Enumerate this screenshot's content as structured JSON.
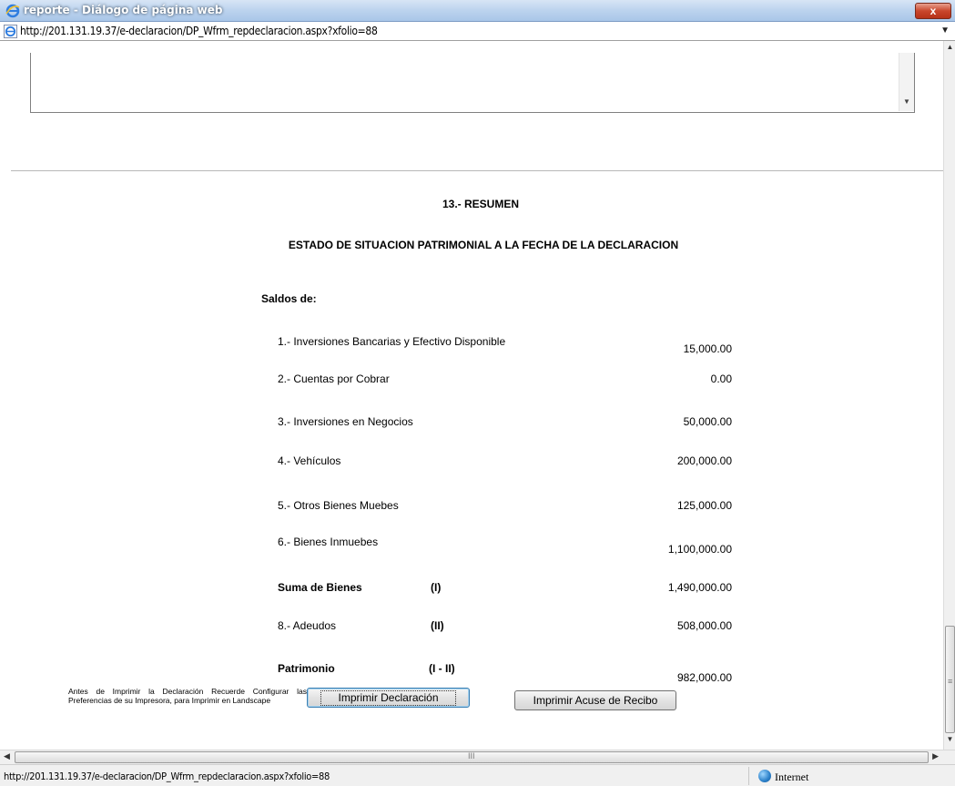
{
  "window": {
    "title": "reporte - Diálogo de página web",
    "close_label": "x",
    "address_url": "http://201.131.19.37/e-declaracion/DP_Wfrm_repdeclaracion.aspx?xfolio=88"
  },
  "report": {
    "section_title": "13.- RESUMEN",
    "subtitle": "ESTADO DE SITUACION PATRIMONIAL A LA FECHA DE LA DECLARACION",
    "saldos_label": "Saldos de:",
    "rows": [
      {
        "label": "1.- Inversiones Bancarias y Efectivo Disponible",
        "roman": "",
        "value": "15,000.00"
      },
      {
        "label": "2.- Cuentas por Cobrar",
        "roman": "",
        "value": "0.00"
      },
      {
        "label": "3.- Inversiones en Negocios",
        "roman": "",
        "value": "50,000.00"
      },
      {
        "label": "4.- Vehículos",
        "roman": "",
        "value": "200,000.00"
      },
      {
        "label": "5.- Otros Bienes Muebes",
        "roman": "",
        "value": "125,000.00"
      },
      {
        "label": "6.- Bienes Inmuebes",
        "roman": "",
        "value": "1,100,000.00"
      },
      {
        "label": "Suma de Bienes",
        "roman": "(I)",
        "value": "1,490,000.00"
      },
      {
        "label": "8.- Adeudos",
        "roman": "(II)",
        "value": "508,000.00"
      },
      {
        "label": "Patrimonio",
        "roman": "(I - II)",
        "value": "982,000.00"
      }
    ]
  },
  "footer": {
    "note": "Antes de Imprimir la Declaración Recuerde Configurar las Preferencias de su Impresora, para Imprimir en Landscape",
    "print_button": "Imprimir Declaración",
    "receipt_button": "Imprimir Acuse de Recibo"
  },
  "statusbar": {
    "url": "http://201.131.19.37/e-declaracion/DP_Wfrm_repdeclaracion.aspx?xfolio=88",
    "zone": "Internet"
  },
  "colors": {
    "titlebar": "#bcd3ee",
    "close_button": "#c9462c",
    "internet_globe": "#2a7fc8"
  },
  "icons": [
    "ie-icon",
    "close-icon",
    "dropdown-icon",
    "globe-icon",
    "scroll-arrow-icon"
  ]
}
